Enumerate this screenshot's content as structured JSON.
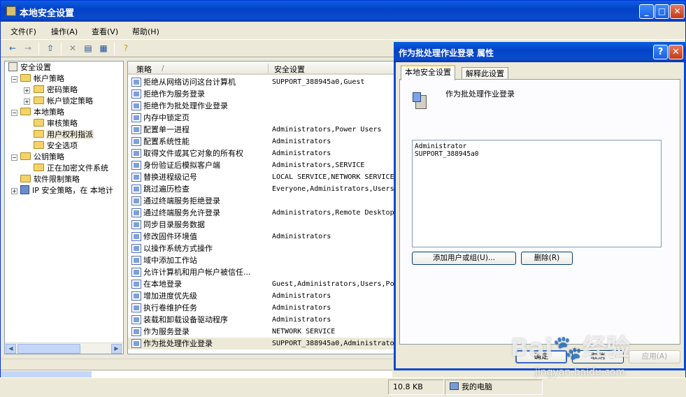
{
  "window": {
    "title": "本地安全设置",
    "controls": [
      "_",
      "□",
      "✕"
    ]
  },
  "menu": [
    "文件(F)",
    "操作(A)",
    "查看(V)",
    "帮助(H)"
  ],
  "toolbar": {
    "icons": [
      "back-icon",
      "forward-icon",
      "up-folder-icon",
      "delete-icon",
      "properties-icon",
      "export-icon",
      "help-icon"
    ]
  },
  "tree": [
    {
      "label": "安全设置",
      "icon": "shield"
    },
    {
      "label": "帐户策略",
      "icon": "folder",
      "expander": "−"
    },
    {
      "label": "密码策略",
      "icon": "folder",
      "expander": "+"
    },
    {
      "label": "帐户锁定策略",
      "icon": "folder",
      "expander": "+"
    },
    {
      "label": "本地策略",
      "icon": "folder",
      "expander": "−"
    },
    {
      "label": "审核策略",
      "icon": "folder"
    },
    {
      "label": "用户权利指派",
      "icon": "folder",
      "selected": true
    },
    {
      "label": "安全选项",
      "icon": "folder"
    },
    {
      "label": "公钥策略",
      "icon": "folder",
      "expander": "−"
    },
    {
      "label": "正在加密文件系统",
      "icon": "folder"
    },
    {
      "label": "软件限制策略",
      "icon": "folder"
    },
    {
      "label": "IP 安全策略，在 本地计",
      "icon": "net",
      "expander": "+"
    }
  ],
  "list": {
    "columns": [
      "策略",
      "/",
      "安全设置"
    ],
    "rows": [
      {
        "name": "拒绝从网络访问这台计算机",
        "setting": "SUPPORT_388945a0,Guest"
      },
      {
        "name": "拒绝作为服务登录",
        "setting": ""
      },
      {
        "name": "拒绝作为批处理作业登录",
        "setting": ""
      },
      {
        "name": "内存中锁定页",
        "setting": ""
      },
      {
        "name": "配置单一进程",
        "setting": "Administrators,Power Users"
      },
      {
        "name": "配置系统性能",
        "setting": "Administrators"
      },
      {
        "name": "取得文件或其它对象的所有权",
        "setting": "Administrators"
      },
      {
        "name": "身份验证后模拟客户端",
        "setting": "Administrators,SERVICE"
      },
      {
        "name": "替换进程级记号",
        "setting": "LOCAL SERVICE,NETWORK SERVICE"
      },
      {
        "name": "跳过遍历检查",
        "setting": "Everyone,Administrators,Users"
      },
      {
        "name": "通过终端服务拒绝登录",
        "setting": ""
      },
      {
        "name": "通过终端服务允许登录",
        "setting": "Administrators,Remote Desktop"
      },
      {
        "name": "同步目录服务数据",
        "setting": ""
      },
      {
        "name": "修改固件环境值",
        "setting": "Administrators"
      },
      {
        "name": "以操作系统方式操作",
        "setting": ""
      },
      {
        "name": "域中添加工作站",
        "setting": ""
      },
      {
        "name": "允许计算机和用户帐户被信任...",
        "setting": ""
      },
      {
        "name": "在本地登录",
        "setting": "Guest,Administrators,Users,Po"
      },
      {
        "name": "增加进度优先级",
        "setting": "Administrators"
      },
      {
        "name": "执行卷维护任务",
        "setting": "Administrators"
      },
      {
        "name": "装载和卸载设备驱动程序",
        "setting": "Administrators"
      },
      {
        "name": "作为服务登录",
        "setting": "NETWORK SERVICE"
      },
      {
        "name": "作为批处理作业登录",
        "setting": "SUPPORT_388945a0,Administrato",
        "selected": true
      }
    ]
  },
  "status": {
    "size": "10.8 KB",
    "location": "我的电脑"
  },
  "dialog": {
    "title": "作为批处理作业登录 属性",
    "controls": [
      "?",
      "✕"
    ],
    "tabs": [
      "本地安全设置",
      "解释此设置"
    ],
    "policy_name": "作为批处理作业登录",
    "users": [
      "Administrator",
      "SUPPORT_388945a0"
    ],
    "add_button": "添加用户或组(U)...",
    "remove_button": "删除(R)",
    "ok_button": "确定",
    "cancel_button": "取消",
    "apply_button": "应用(A)"
  },
  "watermark": {
    "logo": "Bai🐾经验",
    "url": "jingyan.baidu.com"
  }
}
